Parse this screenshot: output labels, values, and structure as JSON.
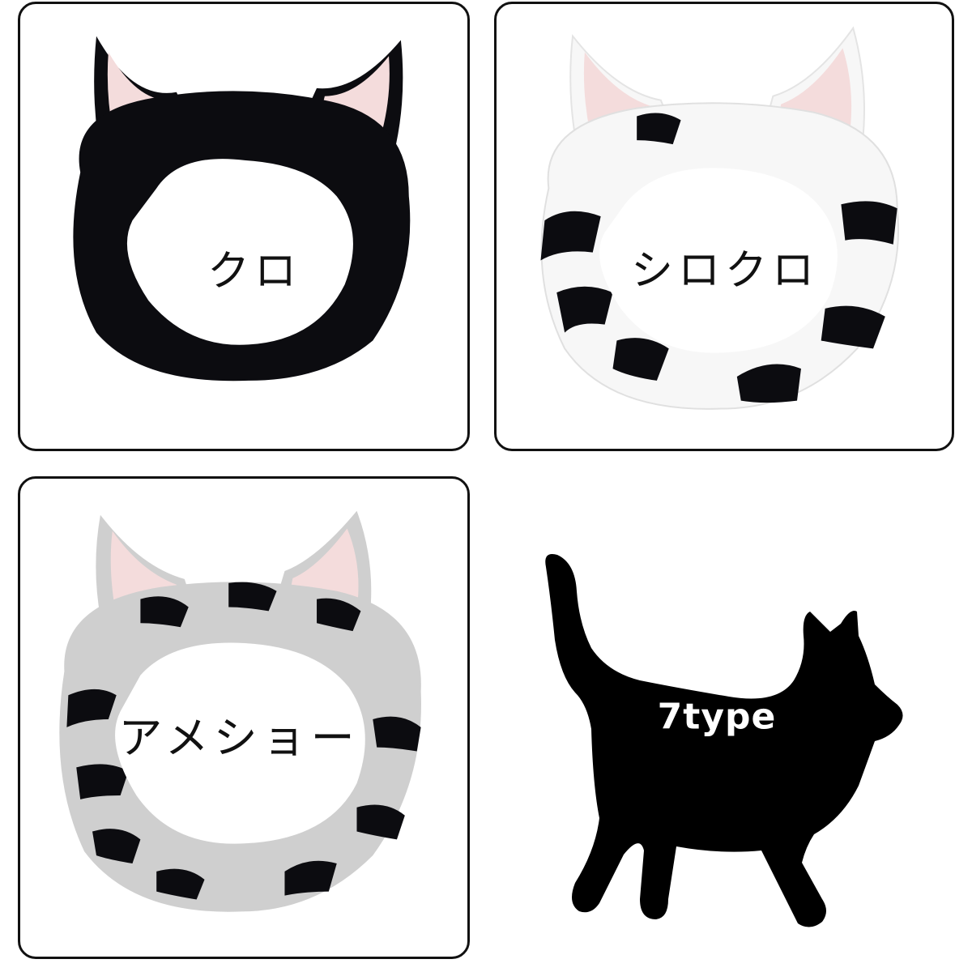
{
  "products": [
    {
      "label": "クロ"
    },
    {
      "label": "シロクロ"
    },
    {
      "label": "アメショー"
    }
  ],
  "promo": {
    "label": "7type"
  },
  "colors": {
    "border": "#111111",
    "fur_black": "#0c0c10",
    "fur_white": "#f7f7f7",
    "fur_gray": "#cfcfcf",
    "ear_pink": "#f4dcdc",
    "silhouette": "#000000"
  },
  "icons": [
    "cat-ear-headband-black",
    "cat-ear-headband-white",
    "cat-ear-headband-gray",
    "cat-silhouette-icon"
  ]
}
